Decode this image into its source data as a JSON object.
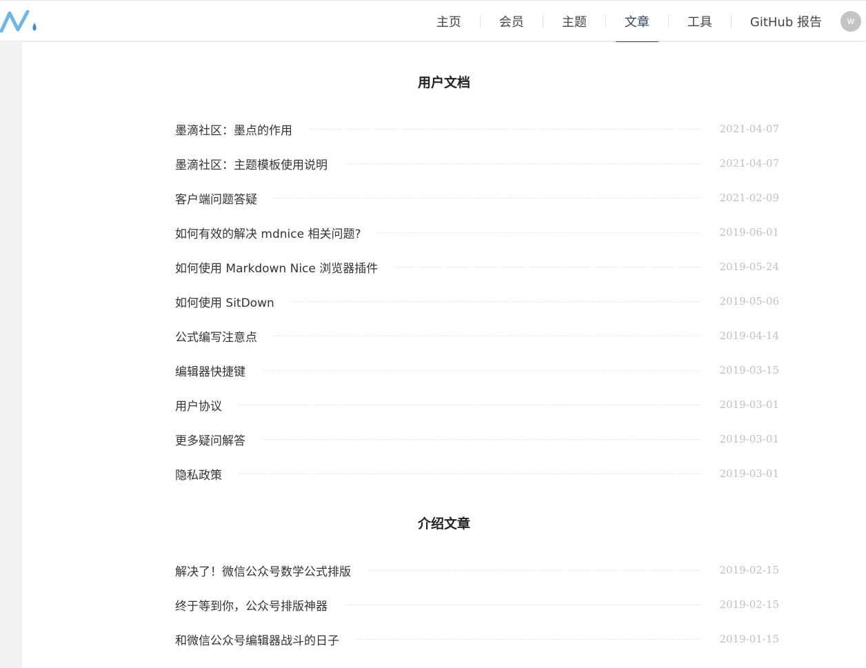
{
  "nav": {
    "items": [
      {
        "label": "主页"
      },
      {
        "label": "会员"
      },
      {
        "label": "主题"
      },
      {
        "label": "文章"
      },
      {
        "label": "工具"
      },
      {
        "label": "GitHub 报告"
      }
    ],
    "active_index": 3,
    "avatar_letter": "w"
  },
  "sections": [
    {
      "title": "用户文档",
      "articles": [
        {
          "title": "墨滴社区：墨点的作用",
          "date": "2021-04-07"
        },
        {
          "title": "墨滴社区：主题模板使用说明",
          "date": "2021-04-07"
        },
        {
          "title": "客户端问题答疑",
          "date": "2021-02-09"
        },
        {
          "title": "如何有效的解决 mdnice 相关问题?",
          "date": "2019-06-01"
        },
        {
          "title": "如何使用 Markdown Nice 浏览器插件",
          "date": "2019-05-24"
        },
        {
          "title": "如何使用 SitDown",
          "date": "2019-05-06"
        },
        {
          "title": "公式编写注意点",
          "date": "2019-04-14"
        },
        {
          "title": "编辑器快捷键",
          "date": "2019-03-15"
        },
        {
          "title": "用户协议",
          "date": "2019-03-01"
        },
        {
          "title": "更多疑问解答",
          "date": "2019-03-01"
        },
        {
          "title": "隐私政策",
          "date": "2019-03-01"
        }
      ]
    },
    {
      "title": "介绍文章",
      "articles": [
        {
          "title": "解决了！微信公众号数学公式排版",
          "date": "2019-02-15"
        },
        {
          "title": "终于等到你，公众号排版神器",
          "date": "2019-02-15"
        },
        {
          "title": "和微信公众号编辑器战斗的日子",
          "date": "2019-01-15"
        }
      ]
    }
  ],
  "colors": {
    "accent": "#35495e",
    "logo_blue": "#4aa3df",
    "date_gray": "#c0c0c0"
  }
}
